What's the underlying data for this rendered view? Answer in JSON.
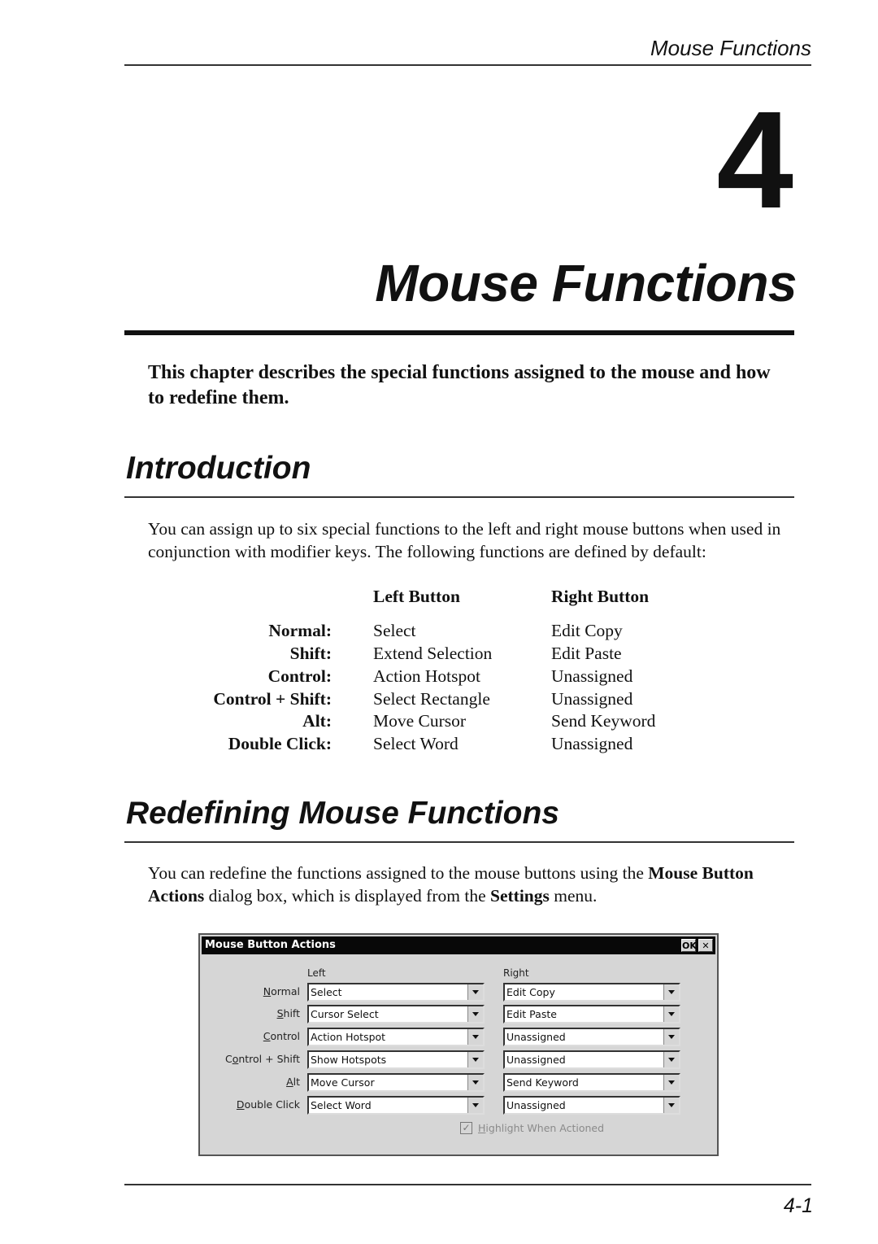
{
  "header": {
    "running_title": "Mouse Functions"
  },
  "chapter": {
    "number": "4",
    "title": "Mouse Functions",
    "lead": "This chapter describes the special functions assigned to the mouse and how to redefine them."
  },
  "introduction": {
    "title": "Introduction",
    "paragraph": "You can assign up to six special functions to the left and right mouse buttons when used in conjunction with modifier keys. The following functions are defined by default:",
    "table": {
      "headers": {
        "left": "Left Button",
        "right": "Right Button"
      },
      "rows": [
        {
          "label": "Normal:",
          "left": "Select",
          "right": "Edit Copy"
        },
        {
          "label": "Shift:",
          "left": "Extend Selection",
          "right": "Edit Paste"
        },
        {
          "label": "Control:",
          "left": "Action Hotspot",
          "right": "Unassigned"
        },
        {
          "label": "Control + Shift:",
          "left": "Select Rectangle",
          "right": "Unassigned"
        },
        {
          "label": "Alt:",
          "left": "Move Cursor",
          "right": "Send Keyword"
        },
        {
          "label": "Double Click:",
          "left": "Select Word",
          "right": "Unassigned"
        }
      ]
    }
  },
  "redefining": {
    "title": "Redefining Mouse Functions",
    "paragraph_parts": {
      "p1": "You can redefine the functions assigned to the mouse buttons using the ",
      "b1": "Mouse Button Actions",
      "p2": " dialog box, which is displayed from the ",
      "b2": "Settings",
      "p3": " menu."
    }
  },
  "dialog": {
    "title": "Mouse Button Actions",
    "ok_label": "OK",
    "close_label": "✕",
    "left_header": "Left",
    "right_header": "Right",
    "rows": [
      {
        "label_ul": "N",
        "label_rest": "ormal",
        "label_pre": "",
        "left": "Select",
        "right": "Edit Copy"
      },
      {
        "label_ul": "S",
        "label_rest": "hift",
        "label_pre": "",
        "left": "Cursor Select",
        "right": "Edit Paste"
      },
      {
        "label_ul": "C",
        "label_rest": "ontrol",
        "label_pre": "",
        "left": "Action Hotspot",
        "right": "Unassigned"
      },
      {
        "label_ul": "o",
        "label_rest": "ntrol + Shift",
        "label_pre": "C",
        "left": "Show Hotspots",
        "right": "Unassigned"
      },
      {
        "label_ul": "A",
        "label_rest": "lt",
        "label_pre": "",
        "left": "Move Cursor",
        "right": "Send Keyword"
      },
      {
        "label_ul": "D",
        "label_rest": "ouble Click",
        "label_pre": "",
        "left": "Select Word",
        "right": "Unassigned"
      }
    ],
    "checkbox": {
      "label_ul": "H",
      "label_rest": "ighlight When Actioned",
      "checked": true,
      "enabled": false
    }
  },
  "footer": {
    "page_number": "4-1"
  }
}
